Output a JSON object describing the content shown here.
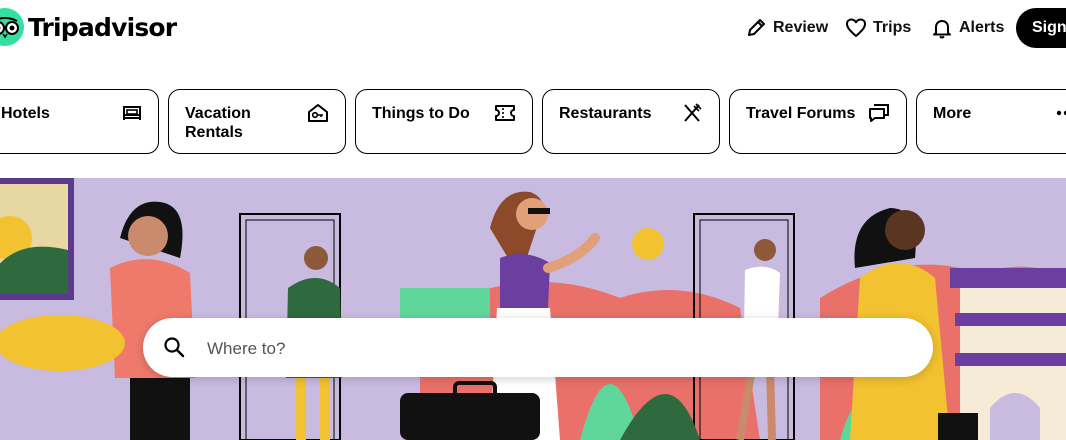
{
  "header": {
    "brand": "Tripadvisor",
    "nav": [
      {
        "label": "Review",
        "icon": "pencil-icon"
      },
      {
        "label": "Trips",
        "icon": "heart-icon"
      },
      {
        "label": "Alerts",
        "icon": "bell-icon"
      }
    ],
    "signin_label": "Sign"
  },
  "categories": [
    {
      "label": "Hotels",
      "icon": "bed-icon"
    },
    {
      "label": "Vacation Rentals",
      "icon": "house-key-icon"
    },
    {
      "label": "Things to Do",
      "icon": "ticket-icon"
    },
    {
      "label": "Restaurants",
      "icon": "utensils-icon"
    },
    {
      "label": "Travel Forums",
      "icon": "chat-bubbles-icon"
    },
    {
      "label": "More",
      "icon": "more-dots-icon"
    }
  ],
  "search": {
    "placeholder": "Where to?",
    "value": ""
  },
  "colors": {
    "brand_green": "#34E0A1",
    "hero_bg": "#C9BBE0",
    "accent_yellow": "#F2C230",
    "accent_coral": "#E9716A",
    "accent_purple": "#6B3FA0"
  }
}
